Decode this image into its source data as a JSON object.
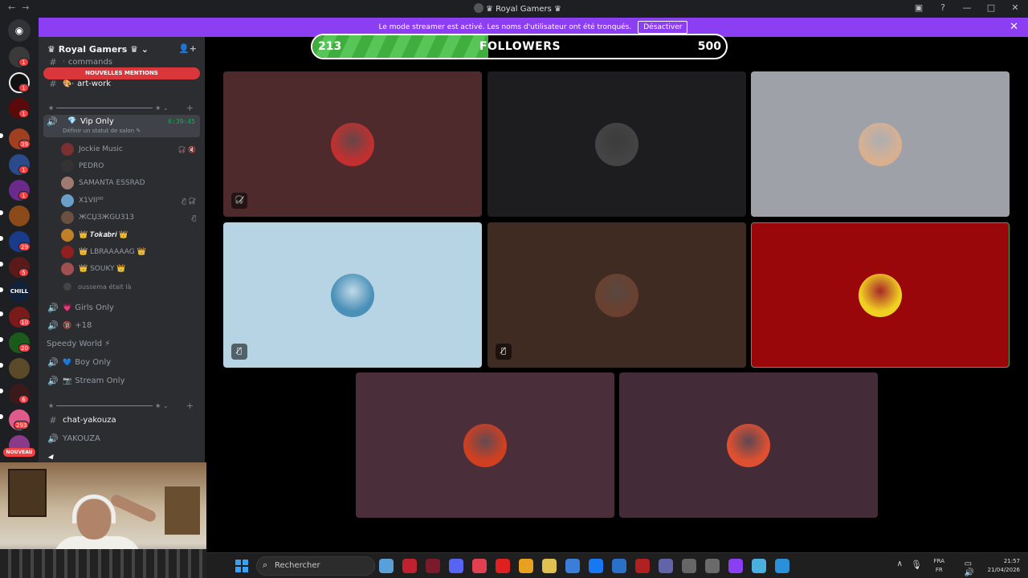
{
  "window": {
    "title": "♛ Royal Gamers ♛",
    "nav_back": "←",
    "nav_forward": "→"
  },
  "banner": {
    "text": "Le mode streamer est activé. Les noms d'utilisateur ont été tronqués.",
    "button": "Désactiver",
    "close_glyph": "✕"
  },
  "rail": {
    "badges": [
      "1",
      "1",
      "1",
      "39",
      "1",
      "1",
      "29",
      "5",
      "10",
      "20",
      "6",
      "293"
    ],
    "chill_label": "CHILL",
    "nouveau_label": "NOUVEAU"
  },
  "server": {
    "name": "♛ Royal Gamers ♛ ⌄",
    "mentions_label": "NOUVELLES MENTIONS",
    "channels_top": [
      {
        "icon": "#",
        "name": "commands"
      },
      {
        "icon": "#",
        "name": "art-work"
      }
    ],
    "vip": {
      "name": "Vip Only",
      "elapsed": "6:39:45",
      "status": "Définir un statut de salon ✎"
    },
    "voice_users": [
      {
        "name": "Jockie Music",
        "color": "#7a3030",
        "status": "🎧̸ 🔇"
      },
      {
        "name": "PEDRO",
        "color": "#333333",
        "status": ""
      },
      {
        "name": "SAMANTA ESSRAD",
        "color": "#a07a70",
        "status": ""
      },
      {
        "name": "X1VII⁰⁰",
        "color": "#6aa0c8",
        "status": "🎙̸ 🎧̸"
      },
      {
        "name": "ЖCЏЗЖGUЗ13",
        "color": "#6a5040",
        "status": "🎙̸"
      },
      {
        "name": "👑 𝑻𝒐𝒌𝒂𝒃𝒓𝒊 👑",
        "color": "#c0802a",
        "status": ""
      },
      {
        "name": "👑 LBRAAAAAG 👑",
        "color": "#902020",
        "status": ""
      },
      {
        "name": "👑 SOUKY 👑",
        "color": "#a05050",
        "status": ""
      }
    ],
    "left_note": "oussema était là",
    "voice_channels": [
      {
        "name": "Girls Only",
        "emoji": "💗"
      },
      {
        "name": "+18",
        "emoji": "🔞"
      },
      {
        "name": "Speedy World ⚡",
        "emoji": ""
      },
      {
        "name": "Boy Only",
        "emoji": "💙"
      },
      {
        "name": "Stream Only",
        "emoji": "📷"
      }
    ],
    "chat_channel": "chat-yakouza",
    "yakouza_voice": "YAKOUZA"
  },
  "follower_goal": {
    "current": "213",
    "label": "FOLLOWERS",
    "goal": "500",
    "progress_fraction": 0.426
  },
  "tiles": [
    {
      "bg": "#4e2a2c",
      "avatar": "#c03030",
      "indicator": "🎧̸"
    },
    {
      "bg": "#1d1d1f",
      "avatar": "#444444",
      "indicator": ""
    },
    {
      "bg": "#9fa1a8",
      "avatar": "#d8b090",
      "indicator": ""
    },
    {
      "bg": "#b6d4e4",
      "avatar": "#4a90b8",
      "indicator": "🎙̸"
    },
    {
      "bg": "#3f2b22",
      "avatar": "#6a4030",
      "indicator": "🎙̸"
    },
    {
      "bg": "#9a070b",
      "avatar": "#f0d020",
      "indicator": ""
    },
    {
      "bg": "#4a2e3a",
      "avatar": "#d04020",
      "indicator": ""
    },
    {
      "bg": "#432b38",
      "avatar": "#e05030",
      "indicator": ""
    }
  ],
  "taskbar": {
    "search_placeholder": "Rechercher",
    "lang_top": "FRA",
    "lang_bottom": "FR",
    "time": "21:57",
    "date": "21/04/2026",
    "app_colors": [
      "#5aa0d8",
      "#c02030",
      "#7a1a2a",
      "#5865f2",
      "#e04050",
      "#e02020",
      "#e8a020",
      "#e0c050",
      "#3a7ed8",
      "#1877f2",
      "#2a70c8",
      "#b02020",
      "#6264a7",
      "#666666",
      "#6a6a6a",
      "#8a3ff2",
      "#4ab0e0",
      "#2a90d8"
    ]
  }
}
